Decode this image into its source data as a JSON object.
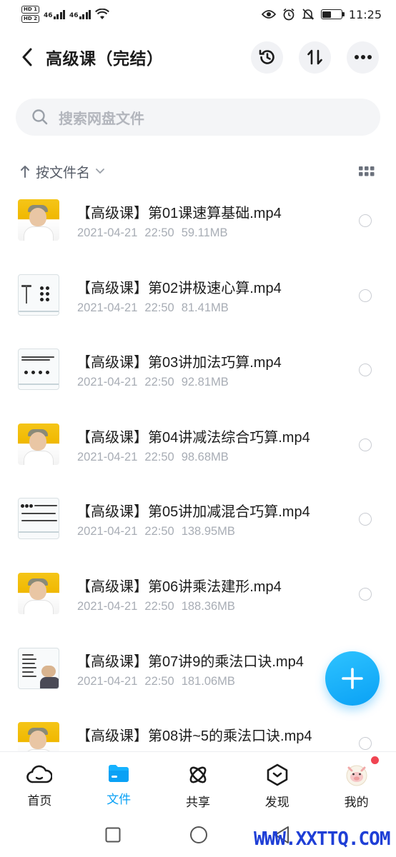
{
  "status_bar": {
    "hd1": "HD 1",
    "hd2": "HD 2",
    "net1": "46",
    "net2": "46",
    "time": "11:25",
    "battery_level": 0.45
  },
  "header": {
    "title": "高级课（完结）",
    "icons": [
      "back-icon",
      "history-icon",
      "sort-icon",
      "more-icon"
    ]
  },
  "search": {
    "placeholder": "搜索网盘文件"
  },
  "sort": {
    "label": "按文件名"
  },
  "files": [
    {
      "name": "【高级课】第01课速算基础.mp4",
      "date": "2021-04-21",
      "time": "22:50",
      "size": "59.11MB",
      "thumb": "video"
    },
    {
      "name": "【高级课】第02讲极速心算.mp4",
      "date": "2021-04-21",
      "time": "22:50",
      "size": "81.41MB",
      "thumb": "board"
    },
    {
      "name": "【高级课】第03讲加法巧算.mp4",
      "date": "2021-04-21",
      "time": "22:50",
      "size": "92.81MB",
      "thumb": "board"
    },
    {
      "name": "【高级课】第04讲减法综合巧算.mp4",
      "date": "2021-04-21",
      "time": "22:50",
      "size": "98.68MB",
      "thumb": "video"
    },
    {
      "name": "【高级课】第05讲加减混合巧算.mp4",
      "date": "2021-04-21",
      "time": "22:50",
      "size": "138.95MB",
      "thumb": "board"
    },
    {
      "name": "【高级课】第06讲乘法建形.mp4",
      "date": "2021-04-21",
      "time": "22:50",
      "size": "188.36MB",
      "thumb": "video"
    },
    {
      "name": "【高级课】第07讲9的乘法口诀.mp4",
      "date": "2021-04-21",
      "time": "22:50",
      "size": "181.06MB",
      "thumb": "board"
    },
    {
      "name": "【高级课】第08讲~5的乘法口诀.mp4",
      "date": "",
      "time": "",
      "size": "",
      "thumb": "video"
    }
  ],
  "bottom_nav": [
    {
      "label": "首页",
      "icon": "cloud-home-icon"
    },
    {
      "label": "文件",
      "icon": "folder-icon",
      "active": true
    },
    {
      "label": "共享",
      "icon": "share-atom-icon"
    },
    {
      "label": "发现",
      "icon": "discover-icon"
    },
    {
      "label": "我的",
      "icon": "avatar-pig-icon"
    }
  ],
  "watermark": "WWW.XXTTQ.COM",
  "colors": {
    "accent": "#0aa1f5",
    "badge_red": "#f04452",
    "meta_gray": "#a8adb5"
  }
}
